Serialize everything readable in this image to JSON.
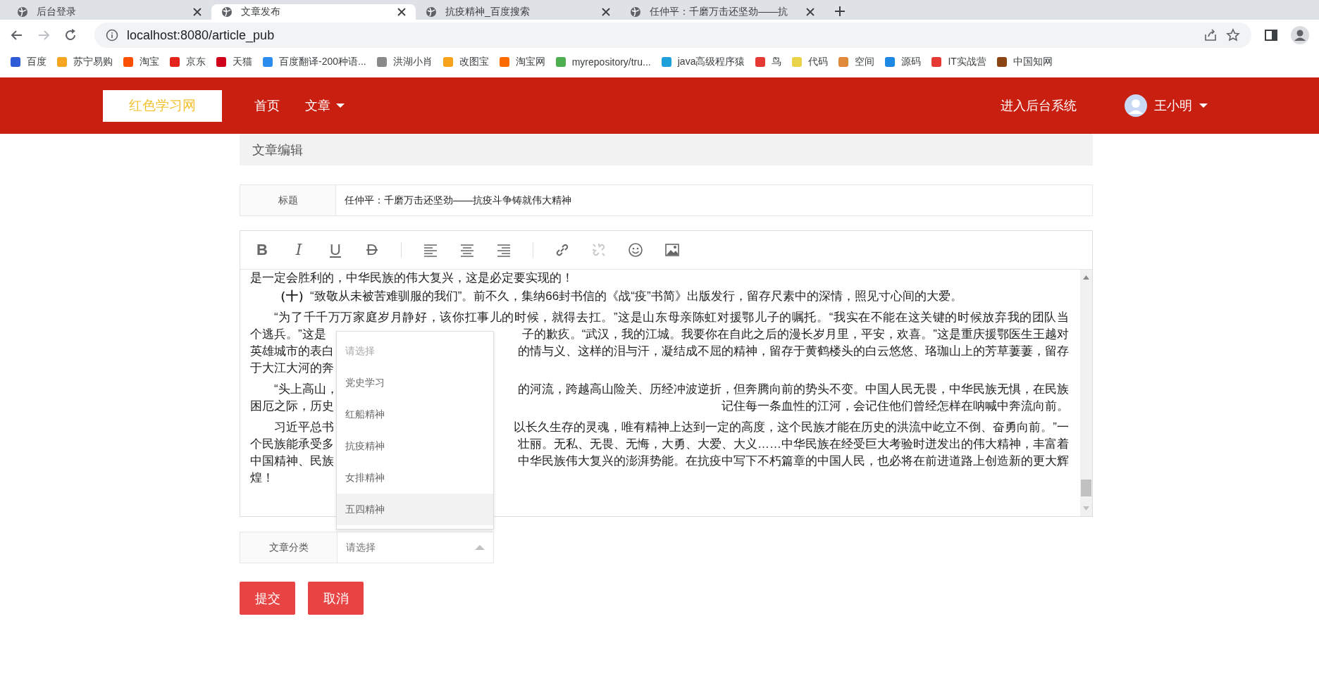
{
  "browser": {
    "tabs": [
      {
        "title": "后台登录",
        "selected": false
      },
      {
        "title": "文章发布",
        "selected": true
      },
      {
        "title": "抗疫精神_百度搜索",
        "selected": false
      },
      {
        "title": "任仲平：千磨万击还坚劲——抗",
        "selected": false
      }
    ],
    "address": "localhost:8080/article_pub",
    "bookmarks": [
      {
        "label": "百度",
        "color": "#2f5bd8"
      },
      {
        "label": "苏宁易购",
        "color": "#f5a623"
      },
      {
        "label": "淘宝",
        "color": "#ff5000"
      },
      {
        "label": "京东",
        "color": "#e1251b"
      },
      {
        "label": "天猫",
        "color": "#d0021b"
      },
      {
        "label": "百度翻译-200种语...",
        "color": "#2d8cf0"
      },
      {
        "label": "洪湖小肖",
        "color": "#8a8a8a"
      },
      {
        "label": "改图宝",
        "color": "#f7a21b"
      },
      {
        "label": "淘宝网",
        "color": "#ff6a00"
      },
      {
        "label": "myrepository/tru...",
        "color": "#4caf50"
      },
      {
        "label": "java高级程序猿",
        "color": "#20a0da"
      },
      {
        "label": "鸟",
        "color": "#e53935"
      },
      {
        "label": "代码",
        "color": "#e8d34a"
      },
      {
        "label": "空间",
        "color": "#e08a3c"
      },
      {
        "label": "源码",
        "color": "#1e88e5"
      },
      {
        "label": "IT实战营",
        "color": "#e53935"
      },
      {
        "label": "中国知网",
        "color": "#8b4513"
      }
    ]
  },
  "navbar": {
    "logo": "红色学习网",
    "items": [
      {
        "label": "首页",
        "dropdown": false
      },
      {
        "label": "文章",
        "dropdown": true
      }
    ],
    "admin_link": "进入后台系统",
    "user": "王小明"
  },
  "panel": {
    "heading": "文章编辑"
  },
  "title_field": {
    "label": "标题",
    "value": "任仲平：千磨万击还坚劲——抗疫斗争铸就伟大精神"
  },
  "editor": {
    "toolbar": [
      {
        "kind": "bold",
        "label": "B"
      },
      {
        "kind": "italic",
        "label": "I"
      },
      {
        "kind": "underline",
        "label": "U"
      },
      {
        "kind": "strike",
        "label": "D"
      },
      {
        "kind": "separator"
      },
      {
        "kind": "align-left"
      },
      {
        "kind": "align-center"
      },
      {
        "kind": "align-right"
      },
      {
        "kind": "separator"
      },
      {
        "kind": "link",
        "disabled": false
      },
      {
        "kind": "unlink",
        "disabled": true
      },
      {
        "kind": "emoji"
      },
      {
        "kind": "image"
      }
    ],
    "lines": [
      {
        "kind": "cut",
        "parts": [
          "是一定会胜利的，中华民族的伟大复兴，这是必定要实现的！"
        ]
      },
      {
        "kind": "single",
        "parts": [
          "**（十）**“致敬从未被苦难驯服的我们”。前不久，集纳66封书信的《战“疫”书简》出版发行，留存尺素中的深情，照见寸心间的大爱。"
        ]
      },
      {
        "kind": "start",
        "parts": [
          "“为了千千万万家庭岁月静好，该你扛事儿的时候，就得去扛。”这是山东母亲陈虹对援鄂儿子的嘱托。“我实在不能在这关键的时候放弃我的团队当"
        ]
      },
      {
        "kind": "split",
        "parts": [
          "个逃兵。”这是",
          "子的歉疚。“武汉，我的江城。我要你在自此之后的漫长岁月里，平安，欢喜。”这是重庆援鄂医生王越对"
        ]
      },
      {
        "kind": "split",
        "parts": [
          "英雄城市的表白",
          "的情与义、这样的泪与汗，凝结成不屈的精神，留存于黄鹤楼头的白云悠悠、珞珈山上的芳草萋萋，留存"
        ]
      },
      {
        "kind": "split",
        "parts": [
          "于大江大河的奔"
        ]
      },
      {
        "kind": "start-split",
        "parts": [
          "“头上高山，",
          "的河流，跨越高山险关、历经冲波逆折，但奔腾向前的势头不变。中国人民无畏，中华民族无惧，在民族"
        ]
      },
      {
        "kind": "split",
        "parts": [
          "困厄之际，历史",
          "记住每一条血性的江河，会记住他们曾经怎样在呐喊中奔流向前。"
        ]
      },
      {
        "kind": "start-split",
        "parts": [
          "习近平总书",
          "以长久生存的灵魂，唯有精神上达到一定的高度，这个民族才能在历史的洪流中屹立不倒、奋勇向前。”一"
        ]
      },
      {
        "kind": "split",
        "parts": [
          "个民族能承受多",
          "壮丽。无私、无畏、无悔，大勇、大爱、大义……中华民族在经受巨大考验时迸发出的伟大精神，丰富着"
        ]
      },
      {
        "kind": "split",
        "parts": [
          "中国精神、民族",
          "中华民族伟大复兴的澎湃势能。在抗疫中写下不朽篇章的中国人民，也必将在前进道路上创造新的更大辉"
        ]
      },
      {
        "kind": "end",
        "parts": [
          "煌！"
        ]
      }
    ]
  },
  "category": {
    "label": "文章分类",
    "placeholder": "请选择",
    "expanded": true,
    "options": [
      {
        "label": "请选择",
        "kind": "placeholder",
        "hovered": false
      },
      {
        "label": "党史学习",
        "kind": "option",
        "hovered": false
      },
      {
        "label": "红船精神",
        "kind": "option",
        "hovered": false
      },
      {
        "label": "抗疫精神",
        "kind": "option",
        "hovered": false
      },
      {
        "label": "女排精神",
        "kind": "option",
        "hovered": false
      },
      {
        "label": "五四精神",
        "kind": "option",
        "hovered": true
      }
    ]
  },
  "buttons": [
    {
      "label": "提交"
    },
    {
      "label": "取消"
    }
  ]
}
